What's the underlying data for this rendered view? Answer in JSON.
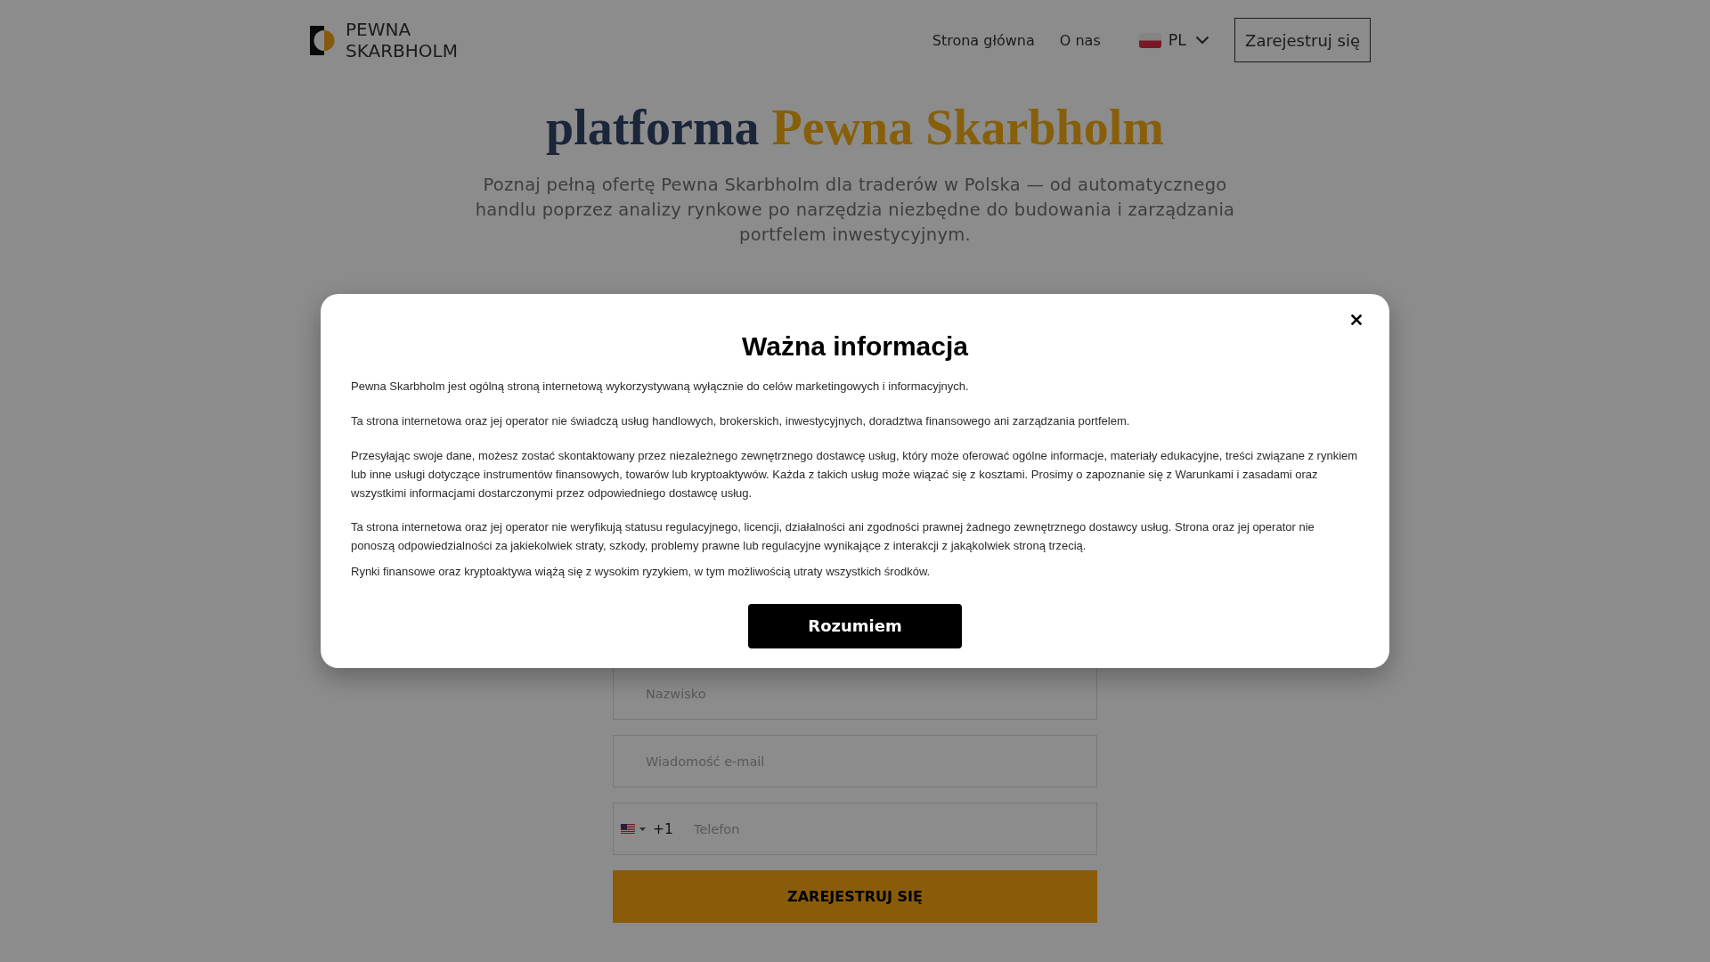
{
  "header": {
    "logo_text": "PEWNA SKARBHOLM",
    "nav": [
      {
        "label": "Strona główna"
      },
      {
        "label": "O nas"
      }
    ],
    "language": {
      "code": "PL"
    },
    "register_button": "Zarejestruj się"
  },
  "hero": {
    "title_parts": [
      {
        "text": "platforma",
        "kind": "plain"
      },
      {
        "text": "Pewna Skarbholm",
        "kind": "accent"
      }
    ],
    "subtitle": "Poznaj pełną ofertę Pewna Skarbholm dla traderów w Polska — od automatycznego handlu poprzez analizy rynkowe po narzędzia niezbędne do budowania i zarządzania portfelem inwestycyjnym."
  },
  "modal": {
    "title": "Ważna informacja",
    "paragraphs": [
      "Pewna Skarbholm jest ogólną stroną internetową wykorzystywaną wyłącznie do celów marketingowych i informacyjnych.",
      "Ta strona internetowa oraz jej operator nie świadczą usług handlowych, brokerskich, inwestycyjnych, doradztwa finansowego ani zarządzania portfelem.",
      "Przesyłając swoje dane, możesz zostać skontaktowany przez niezależnego zewnętrznego dostawcę usług, który może oferować ogólne informacje, materiały edukacyjne, treści związane z rynkiem lub inne usługi dotyczące instrumentów finansowych, towarów lub kryptoaktywów. Każda z takich usług może wiązać się z kosztami. Prosimy o zapoznanie się z Warunkami i zasadami oraz wszystkimi informacjami dostarczonymi przez odpowiedniego dostawcę usług.",
      "Ta strona internetowa oraz jej operator nie weryfikują statusu regulacyjnego, licencji, działalności ani zgodności prawnej żadnego zewnętrznego dostawcy usług. Strona oraz jej operator nie ponoszą odpowiedzialności za jakiekolwiek straty, szkody, problemy prawne lub regulacyjne wynikające z interakcji z jakąkolwiek stroną trzecią.",
      "Rynki finansowe oraz kryptoaktywa wiążą się z wysokim ryzykiem, w tym możliwością utraty wszystkich środków."
    ],
    "button": "Rozumiem"
  },
  "form": {
    "fields": [
      {
        "kind": "text",
        "placeholder": "Nazwisko"
      },
      {
        "kind": "email",
        "placeholder": "Wiadomość e-mail"
      },
      {
        "kind": "phone",
        "dial_code": "+1",
        "placeholder": "Telefon"
      }
    ],
    "submit": "ZAREJESTRUJ SIĘ"
  }
}
